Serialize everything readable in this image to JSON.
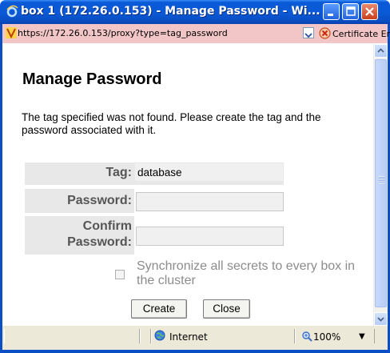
{
  "window": {
    "title": "box 1 (172.26.0.153) - Manage Password - Wi...",
    "icon": "ie-icon"
  },
  "address_bar": {
    "url": "https://172.26.0.153/proxy?type=tag_password",
    "cert_label": "Certificate Error"
  },
  "page": {
    "heading": "Manage Password",
    "message": "The tag specified was not found. Please create the tag and the password associated with it.",
    "form": {
      "tag_label": "Tag:",
      "tag_value": "database",
      "password_label": "Password:",
      "password_value": "",
      "confirm_label_line1": "Confirm",
      "confirm_label_line2": "Password:",
      "confirm_value": "",
      "sync_label": "Synchronize all secrets to every box in the cluster",
      "sync_checked": false
    },
    "buttons": {
      "create": "Create",
      "close": "Close"
    }
  },
  "status_bar": {
    "zone": "Internet",
    "zoom": "100%"
  },
  "colors": {
    "titlebar": "#0a5ad8",
    "addressbar_error": "#f2c6c6",
    "label_bg": "#e8e8e8"
  }
}
